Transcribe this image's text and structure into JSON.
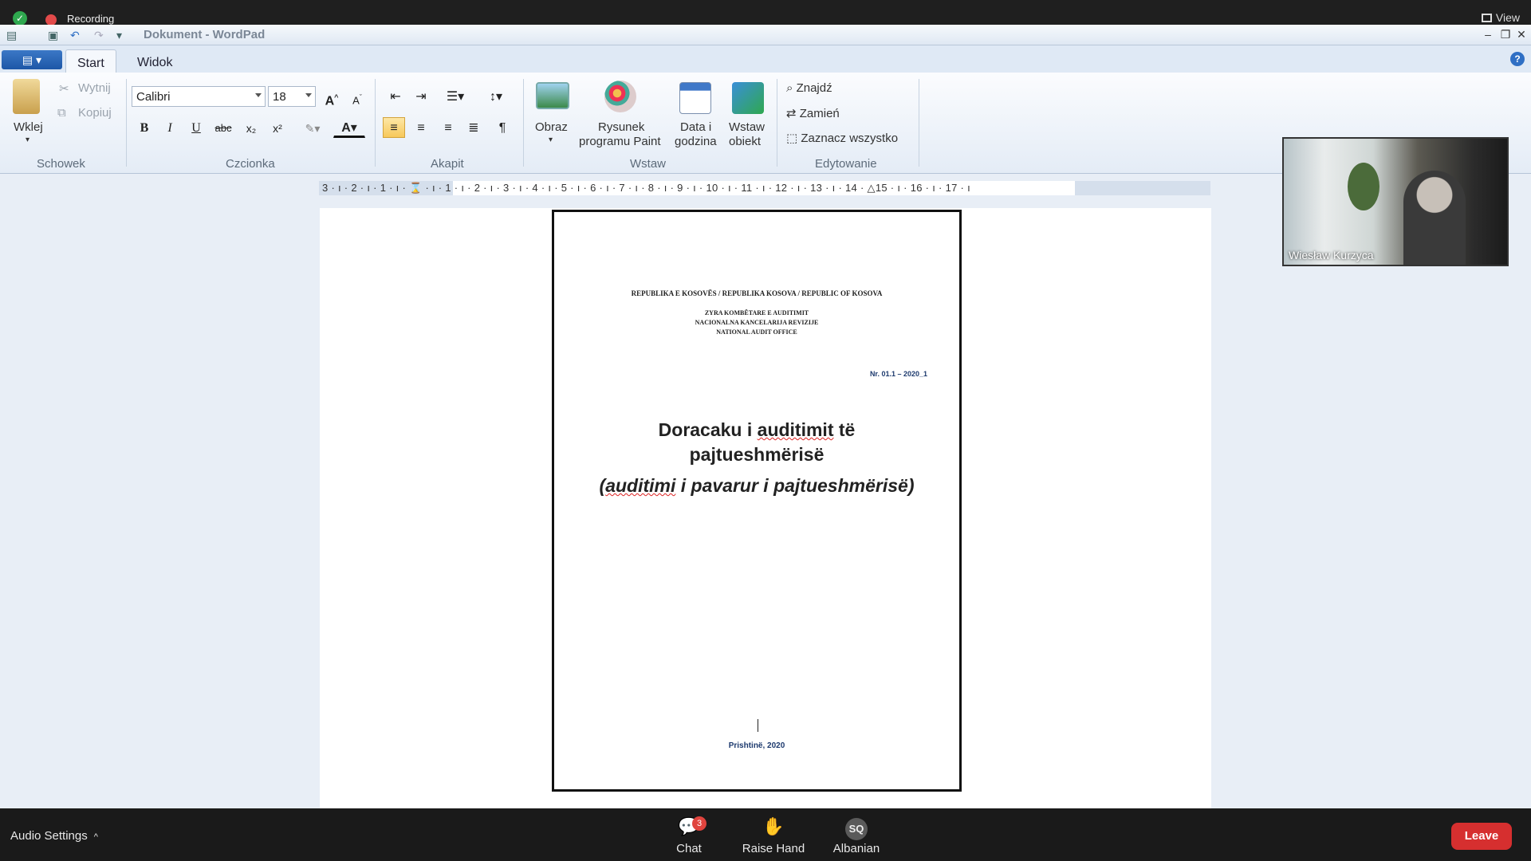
{
  "meeting": {
    "recording_label": "Recording",
    "view_label": "View"
  },
  "window": {
    "title": "Dokument - WordPad"
  },
  "tabs": [
    {
      "label": "Start",
      "active": true
    },
    {
      "label": "Widok",
      "active": false
    }
  ],
  "ribbon": {
    "clipboard": {
      "group_label": "Schowek",
      "paste_label": "Wklej",
      "cut_label": "Wytnij",
      "copy_label": "Kopiuj"
    },
    "font": {
      "group_label": "Czcionka",
      "font_name": "Calibri",
      "font_size": "18",
      "bold": "B",
      "italic": "I",
      "underline": "U",
      "strike": "abc"
    },
    "paragraph": {
      "group_label": "Akapit"
    },
    "insert": {
      "group_label": "Wstaw",
      "picture_label": "Obraz",
      "paint_label_1": "Rysunek",
      "paint_label_2": "programu Paint",
      "datetime_label_1": "Data i",
      "datetime_label_2": "godzina",
      "object_label_1": "Wstaw",
      "object_label_2": "obiekt"
    },
    "editing": {
      "group_label": "Edytowanie",
      "find_label": "Znajdź",
      "replace_label": "Zamień",
      "select_all_label": "Zaznacz wszystko"
    }
  },
  "ruler": {
    "numbers": "3 · ı · 2 · ı · 1 · ı · ⌛ · ı · 1 · ı · 2 · ı · 3 · ı · 4 · ı · 5 · ı · 6 · ı · 7 · ı · 8 · ı · 9 · ı · 10 · ı · 11 · ı · 12 · ı · 13 · ı · 14 · △15 · ı · 16 · ı · 17 · ı"
  },
  "document": {
    "header_line1": "REPUBLIKA E KOSOVËS / REPUBLIKA KOSOVA / REPUBLIC OF KOSOVA",
    "header_line2": "ZYRA KOMBËTARE E AUDITIMIT",
    "header_line3": "NACIONALNA KANCELARIJA REVIZIJE",
    "header_line4": "NATIONAL AUDIT OFFICE",
    "number": "Nr. 01.1 – 2020_1",
    "title_a": "Doracaku i ",
    "title_b": "auditimit",
    "title_c": " të",
    "title_line2": "pajtueshmërisë",
    "subtitle_a": "(",
    "subtitle_b": "auditimi",
    "subtitle_c": " i pavarur i pajtueshmërisë)",
    "place_date": "Prishtinë, 2020"
  },
  "participant": {
    "name": "Wiesław Kurzyca"
  },
  "bottom": {
    "audio_settings_label": "Audio Settings",
    "chat_label": "Chat",
    "chat_badge": "3",
    "raise_hand_label": "Raise Hand",
    "language_initials": "SQ",
    "language_label": "Albanian",
    "leave_label": "Leave"
  }
}
